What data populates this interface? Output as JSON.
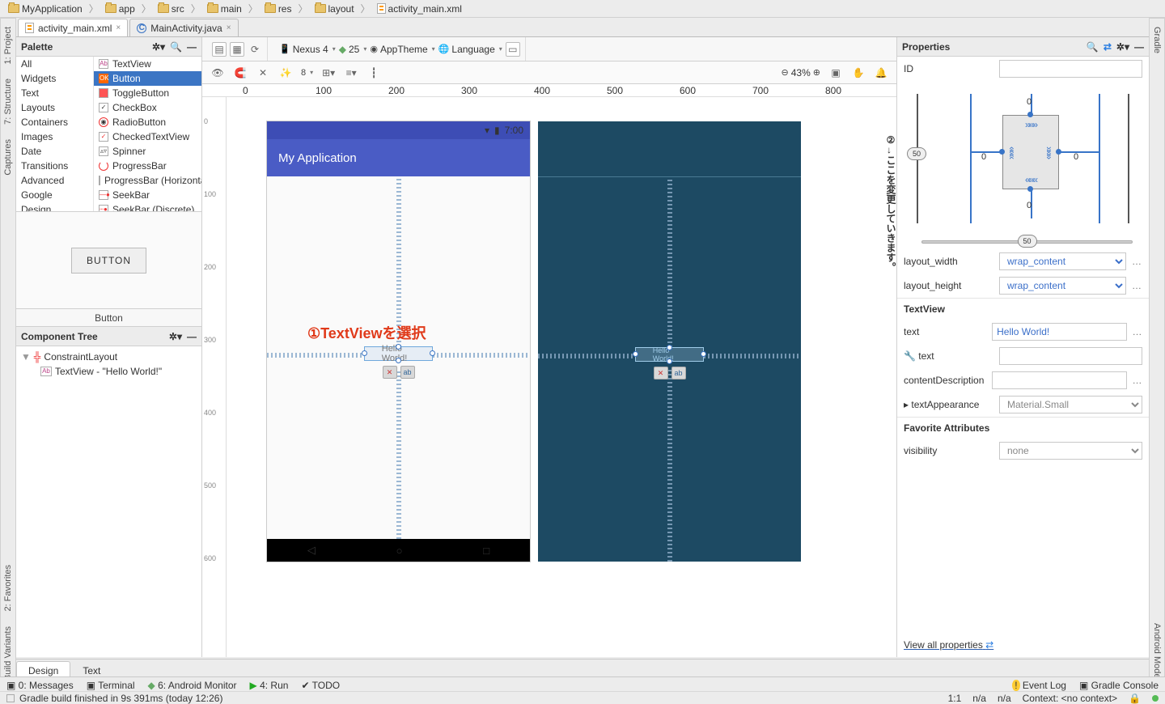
{
  "breadcrumbs": [
    "MyApplication",
    "app",
    "src",
    "main",
    "res",
    "layout",
    "activity_main.xml"
  ],
  "tabs": [
    {
      "label": "activity_main.xml",
      "active": true,
      "kind": "xml"
    },
    {
      "label": "MainActivity.java",
      "active": false,
      "kind": "java"
    }
  ],
  "left_rail": [
    "1: Project",
    "7: Structure",
    "Captures"
  ],
  "left_rail2": [
    "Build Variants",
    "2: Favorites"
  ],
  "right_rail": [
    "Gradle",
    "Android Model"
  ],
  "palette": {
    "title": "Palette",
    "categories": [
      "All",
      "Widgets",
      "Text",
      "Layouts",
      "Containers",
      "Images",
      "Date",
      "Transitions",
      "Advanced",
      "Google",
      "Design"
    ],
    "widgets": [
      "TextView",
      "Button",
      "ToggleButton",
      "CheckBox",
      "RadioButton",
      "CheckedTextView",
      "Spinner",
      "ProgressBar",
      "ProgressBar (Horizontal)",
      "SeekBar",
      "SeekBar (Discrete)"
    ],
    "selected_widget": "Button",
    "preview_label": "BUTTON",
    "preview_caption": "Button"
  },
  "component_tree": {
    "title": "Component Tree",
    "root": "ConstraintLayout",
    "child": "TextView - \"Hello World!\""
  },
  "toolbar": {
    "device": "Nexus 4",
    "api": "25",
    "theme": "AppTheme",
    "lang": "Language",
    "zoom": "43%",
    "margin": "8"
  },
  "device_preview": {
    "time": "7:00",
    "app_title": "My Application",
    "textview_text": "Hello World!"
  },
  "annotations": {
    "a1": "①TextViewを選択",
    "a2_num": "②",
    "a2_text": "→ここを変更していきます。"
  },
  "properties": {
    "title": "Properties",
    "id_label": "ID",
    "id_value": "",
    "constraints": {
      "top": "0",
      "left": "0",
      "right": "0",
      "bottom": "0",
      "bias_h": "50",
      "bias_v": "50"
    },
    "layout_width_label": "layout_width",
    "layout_width": "wrap_content",
    "layout_height_label": "layout_height",
    "layout_height": "wrap_content",
    "section_tv": "TextView",
    "text_label": "text",
    "text": "Hello World!",
    "text2_label": "text",
    "text2": "",
    "cd_label": "contentDescription",
    "cd": "",
    "ta_label": "textAppearance",
    "ta": "Material.Small",
    "fav_section": "Favorite Attributes",
    "vis_label": "visibility",
    "vis": "none",
    "view_all": "View all properties"
  },
  "design_tabs": {
    "design": "Design",
    "text": "Text"
  },
  "bottom": {
    "messages": "0: Messages",
    "terminal": "Terminal",
    "monitor": "6: Android Monitor",
    "run": "4: Run",
    "todo": "TODO",
    "event": "Event Log",
    "gradle": "Gradle Console"
  },
  "status": {
    "msg": "Gradle build finished in 9s 391ms (today 12:26)",
    "pos": "1:1",
    "na": "n/a",
    "na2": "n/a",
    "ctx": "Context: <no context>"
  },
  "ruler_h": [
    "0",
    "100",
    "200",
    "300",
    "400",
    "500",
    "600",
    "700",
    "800"
  ],
  "ruler_v": [
    "0",
    "100",
    "200",
    "300",
    "400",
    "500",
    "600"
  ]
}
